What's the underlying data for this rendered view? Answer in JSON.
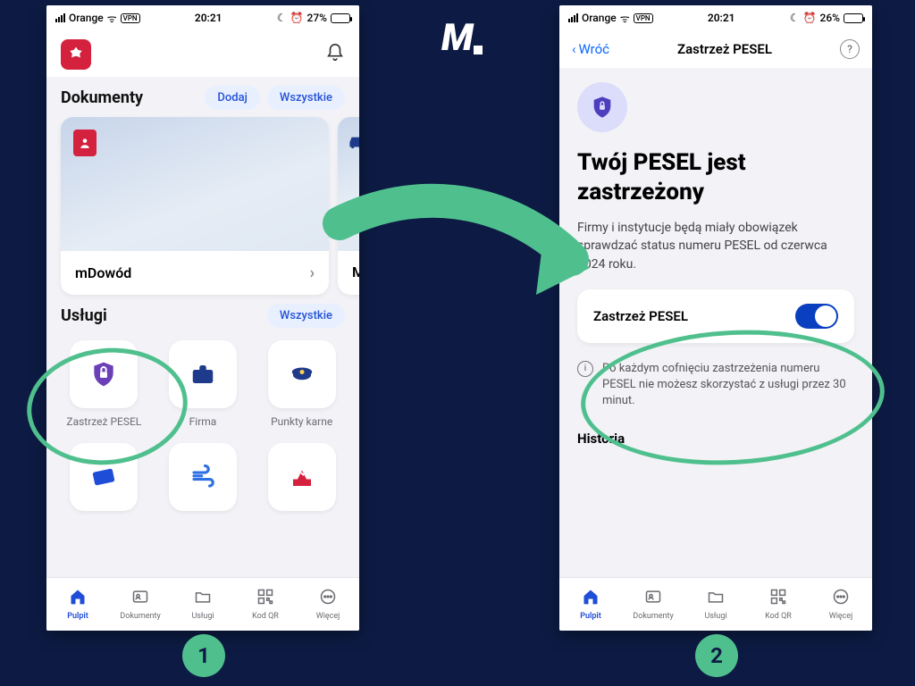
{
  "logo_brand": "M",
  "step_labels": {
    "one": "1",
    "two": "2"
  },
  "status_bar": {
    "carrier": "Orange",
    "vpn": "VPN",
    "time": "20:21",
    "moon": "☾",
    "alarm": "⏰",
    "battery_a": "27%",
    "battery_b": "26%",
    "battery_fill_a": 27,
    "battery_fill_b": 26
  },
  "screen1": {
    "header": {
      "app_emblem": "eagle",
      "notification_icon": "bell"
    },
    "documents": {
      "title": "Dokumenty",
      "add_chip": "Dodaj",
      "all_chip": "Wszystkie",
      "cards": [
        {
          "name": "mDowód",
          "icon": "id-card"
        },
        {
          "name": "Moje",
          "icon": "car"
        }
      ]
    },
    "services": {
      "title": "Usługi",
      "all_chip": "Wszystkie",
      "tiles": [
        {
          "label": "Zastrzeż PESEL",
          "icon": "shield-lock",
          "color": "#6b3fb5"
        },
        {
          "label": "Firma",
          "icon": "briefcase",
          "color": "#1e3a8a"
        },
        {
          "label": "Punkty karne",
          "icon": "police-cap",
          "color": "#1e3a8a"
        },
        {
          "label": "",
          "icon": "card-tilt",
          "color": "#1e4dd8"
        },
        {
          "label": "",
          "icon": "wind",
          "color": "#2f6fe4"
        },
        {
          "label": "",
          "icon": "ballot",
          "color": "#d4213d"
        }
      ]
    }
  },
  "tabbar": {
    "items": [
      {
        "label": "Pulpit",
        "icon": "home",
        "active": true
      },
      {
        "label": "Dokumenty",
        "icon": "id",
        "active": false
      },
      {
        "label": "Usługi",
        "icon": "folder",
        "active": false
      },
      {
        "label": "Kod QR",
        "icon": "qr",
        "active": false
      },
      {
        "label": "Więcej",
        "icon": "more",
        "active": false
      }
    ]
  },
  "screen2": {
    "nav": {
      "back": "Wróć",
      "title": "Zastrzeż PESEL",
      "help": "?"
    },
    "heading": "Twój PESEL jest zastrzeżony",
    "paragraph": "Firmy i instytucje będą miały obowiązek sprawdzać status numeru PESEL od czerwca 2024 roku.",
    "toggle": {
      "label": "Zastrzeż PESEL",
      "on": true
    },
    "info_note": "Po każdym cofnięciu zastrzeżenia numeru PESEL nie możesz skorzystać z usługi przez 30 minut.",
    "history_title": "Historia"
  }
}
